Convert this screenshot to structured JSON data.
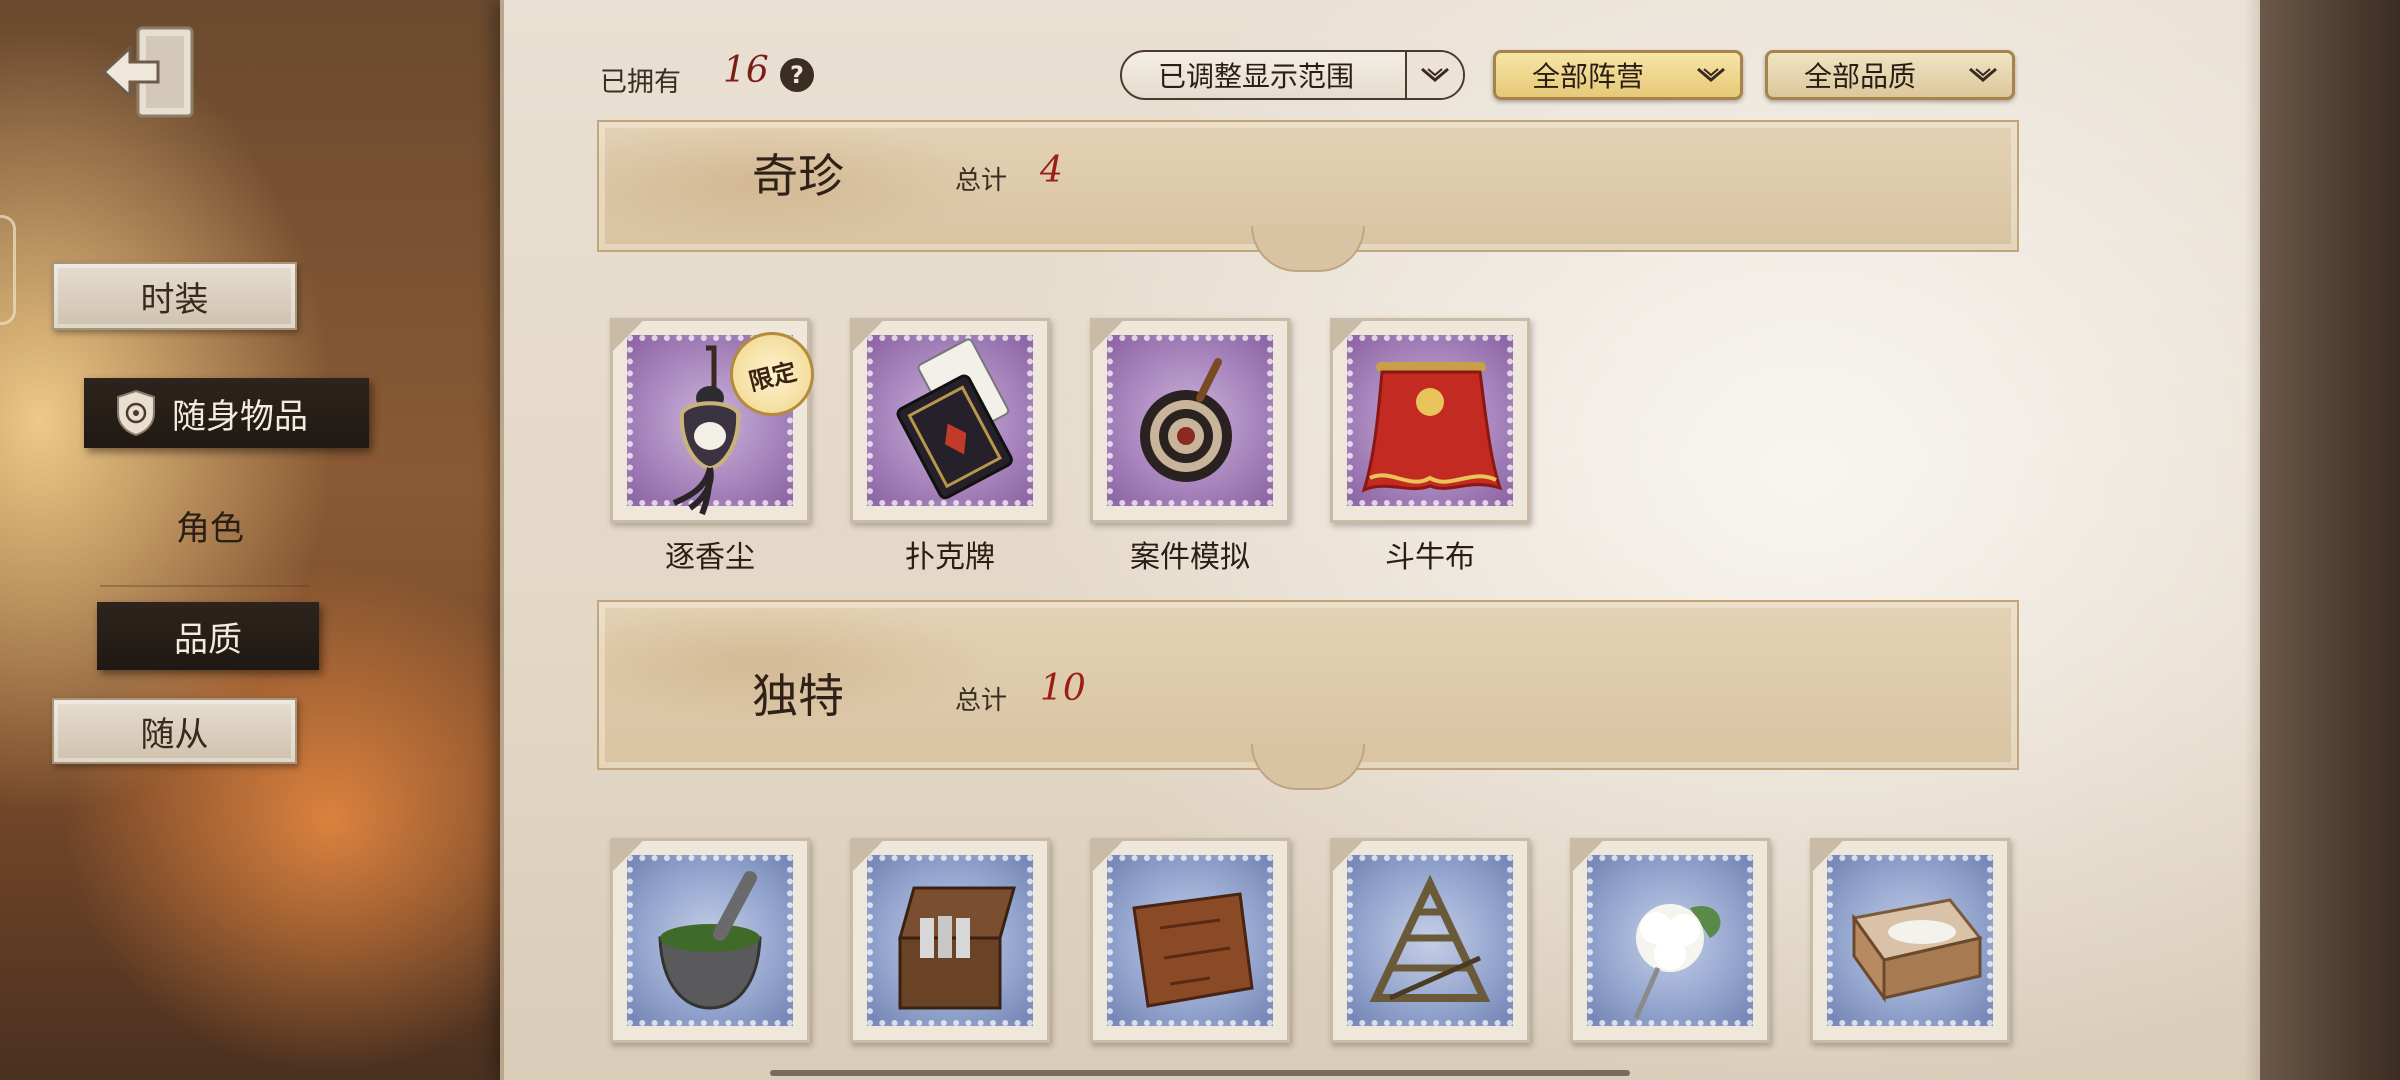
{
  "top": {
    "owned_label": "已拥有",
    "owned_count": "16",
    "help": "?",
    "filter_range": "已调整显示范围",
    "filter_faction": "全部阵营",
    "filter_quality": "全部品质"
  },
  "nav": {
    "items": [
      {
        "label": "时装"
      },
      {
        "label": "随身物品"
      },
      {
        "label": "角色"
      },
      {
        "label": "品质"
      },
      {
        "label": "随从"
      }
    ]
  },
  "sections": [
    {
      "title": "奇珍",
      "total_label": "总计",
      "total": "4",
      "rarity_color": "#a885bd",
      "items": [
        {
          "name": "逐香尘",
          "badge": "限定",
          "icon": "incense-pendant-icon"
        },
        {
          "name": "扑克牌",
          "icon": "playing-cards-icon"
        },
        {
          "name": "案件模拟",
          "icon": "spinning-top-icon"
        },
        {
          "name": "斗牛布",
          "icon": "red-cape-icon"
        }
      ]
    },
    {
      "title": "独特",
      "total_label": "总计",
      "total": "10",
      "rarity_color": "#95a6cf",
      "items": [
        {
          "icon": "mortar-pestle-icon"
        },
        {
          "icon": "open-chest-icon"
        },
        {
          "icon": "leather-map-icon"
        },
        {
          "icon": "wooden-structure-icon"
        },
        {
          "icon": "white-flower-icon"
        },
        {
          "icon": "cotton-box-icon"
        }
      ]
    }
  ]
}
